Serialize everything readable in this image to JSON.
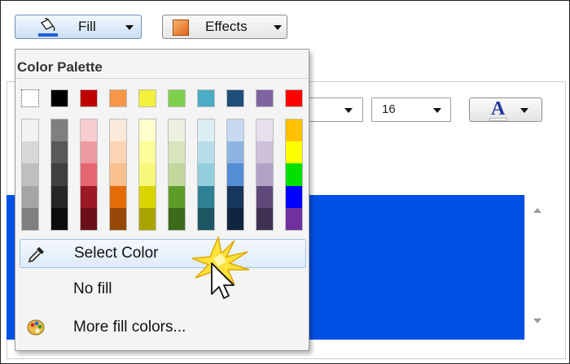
{
  "toolbar": {
    "fill_label": "Fill",
    "effects_label": "Effects"
  },
  "background_panel": {
    "font_size_value": "16",
    "font_color_glyph": "A"
  },
  "fill_menu": {
    "title": "Color Palette",
    "top_colors": [
      "#ffffff",
      "#000000",
      "#c00000",
      "#f79646",
      "#f2f03a",
      "#7ed04a",
      "#4bacc6",
      "#1f4e79",
      "#8064a2",
      "#ff0000"
    ],
    "shade_columns": [
      [
        "#f2f2f2",
        "#d8d8d8",
        "#bfbfbf",
        "#a5a5a5",
        "#7f7f7f"
      ],
      [
        "#7f7f7f",
        "#595959",
        "#3f3f3f",
        "#262626",
        "#0c0c0c"
      ],
      [
        "#f7cdd0",
        "#ee9aa2",
        "#e66672",
        "#9c1826",
        "#6b0f19"
      ],
      [
        "#fde9d9",
        "#fbd4b4",
        "#fabf8f",
        "#e36c09",
        "#974806"
      ],
      [
        "#ffffcc",
        "#fdfd9a",
        "#f6f67a",
        "#d9d400",
        "#a9a400"
      ],
      [
        "#ebf1de",
        "#d7e4bc",
        "#c3d69b",
        "#5e9c2a",
        "#3c6b1a"
      ],
      [
        "#dbeef3",
        "#b7dde8",
        "#92cddc",
        "#2e8193",
        "#1d5562"
      ],
      [
        "#c6d9f0",
        "#8db3e2",
        "#548dd4",
        "#17365d",
        "#0f243e"
      ],
      [
        "#e5e0ec",
        "#ccc1d9",
        "#b2a2c7",
        "#5f497a",
        "#3f3151"
      ],
      [
        "#ffc000",
        "#ffff00",
        "#00e000",
        "#0000ff",
        "#7030a0"
      ]
    ],
    "items": [
      {
        "label": "Select Color",
        "icon": "eyedropper-icon",
        "hovered": true
      },
      {
        "label": "No fill",
        "icon": "",
        "hovered": false
      },
      {
        "label": "More fill colors...",
        "icon": "palette-icon",
        "hovered": false
      }
    ]
  },
  "colors": {
    "fill_underline": "#1e5fd8",
    "selection_blue": "#0050e6",
    "hover_border": "#9cc2e8",
    "click_burst": "#f5c400"
  }
}
